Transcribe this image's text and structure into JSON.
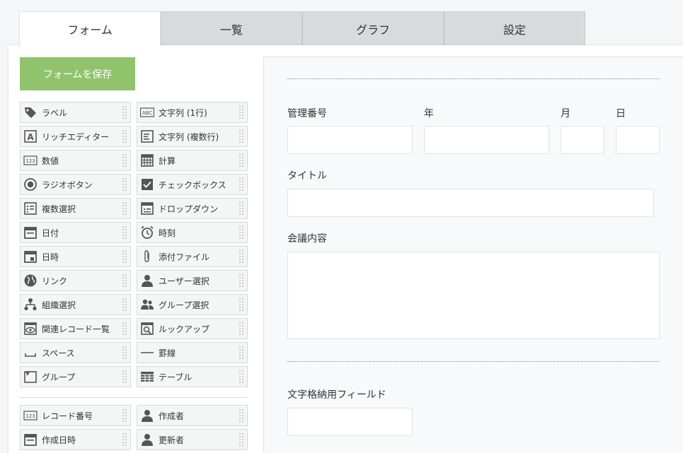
{
  "tabs": [
    "フォーム",
    "一覧",
    "グラフ",
    "設定"
  ],
  "save_button": "フォームを保存",
  "palette_left": [
    {
      "label": "ラベル",
      "icon": "tag-icon"
    },
    {
      "label": "リッチエディター",
      "icon": "rich-editor-icon"
    },
    {
      "label": "数値",
      "icon": "number-icon"
    },
    {
      "label": "ラジオボタン",
      "icon": "radio-icon"
    },
    {
      "label": "複数選択",
      "icon": "multi-select-icon"
    },
    {
      "label": "日付",
      "icon": "date-icon"
    },
    {
      "label": "日時",
      "icon": "datetime-icon"
    },
    {
      "label": "リンク",
      "icon": "globe-icon"
    },
    {
      "label": "組織選択",
      "icon": "org-icon"
    },
    {
      "label": "関連レコード一覧",
      "icon": "related-records-icon"
    },
    {
      "label": "スペース",
      "icon": "space-icon"
    },
    {
      "label": "グループ",
      "icon": "group-icon"
    }
  ],
  "palette_right": [
    {
      "label": "文字列 (1行)",
      "icon": "text-single-icon"
    },
    {
      "label": "文字列 (複数行)",
      "icon": "text-multi-icon"
    },
    {
      "label": "計算",
      "icon": "calculator-icon"
    },
    {
      "label": "チェックボックス",
      "icon": "checkbox-icon"
    },
    {
      "label": "ドロップダウン",
      "icon": "dropdown-icon"
    },
    {
      "label": "時刻",
      "icon": "clock-icon"
    },
    {
      "label": "添付ファイル",
      "icon": "paperclip-icon"
    },
    {
      "label": "ユーザー選択",
      "icon": "user-icon"
    },
    {
      "label": "グループ選択",
      "icon": "users-icon"
    },
    {
      "label": "ルックアップ",
      "icon": "lookup-icon"
    },
    {
      "label": "罫線",
      "icon": "rule-line-icon"
    },
    {
      "label": "テーブル",
      "icon": "table-icon"
    }
  ],
  "palette_system": [
    {
      "label": "レコード番号",
      "icon": "number-icon"
    },
    {
      "label": "作成者",
      "icon": "user-icon"
    },
    {
      "label": "作成日時",
      "icon": "date-icon"
    },
    {
      "label": "更新者",
      "icon": "user-icon"
    }
  ],
  "form": {
    "field_kanri": "管理番号",
    "field_year": "年",
    "field_month": "月",
    "field_day": "日",
    "field_title": "タイトル",
    "field_content": "会議内容",
    "field_storage": "文字格納用フィールド"
  }
}
